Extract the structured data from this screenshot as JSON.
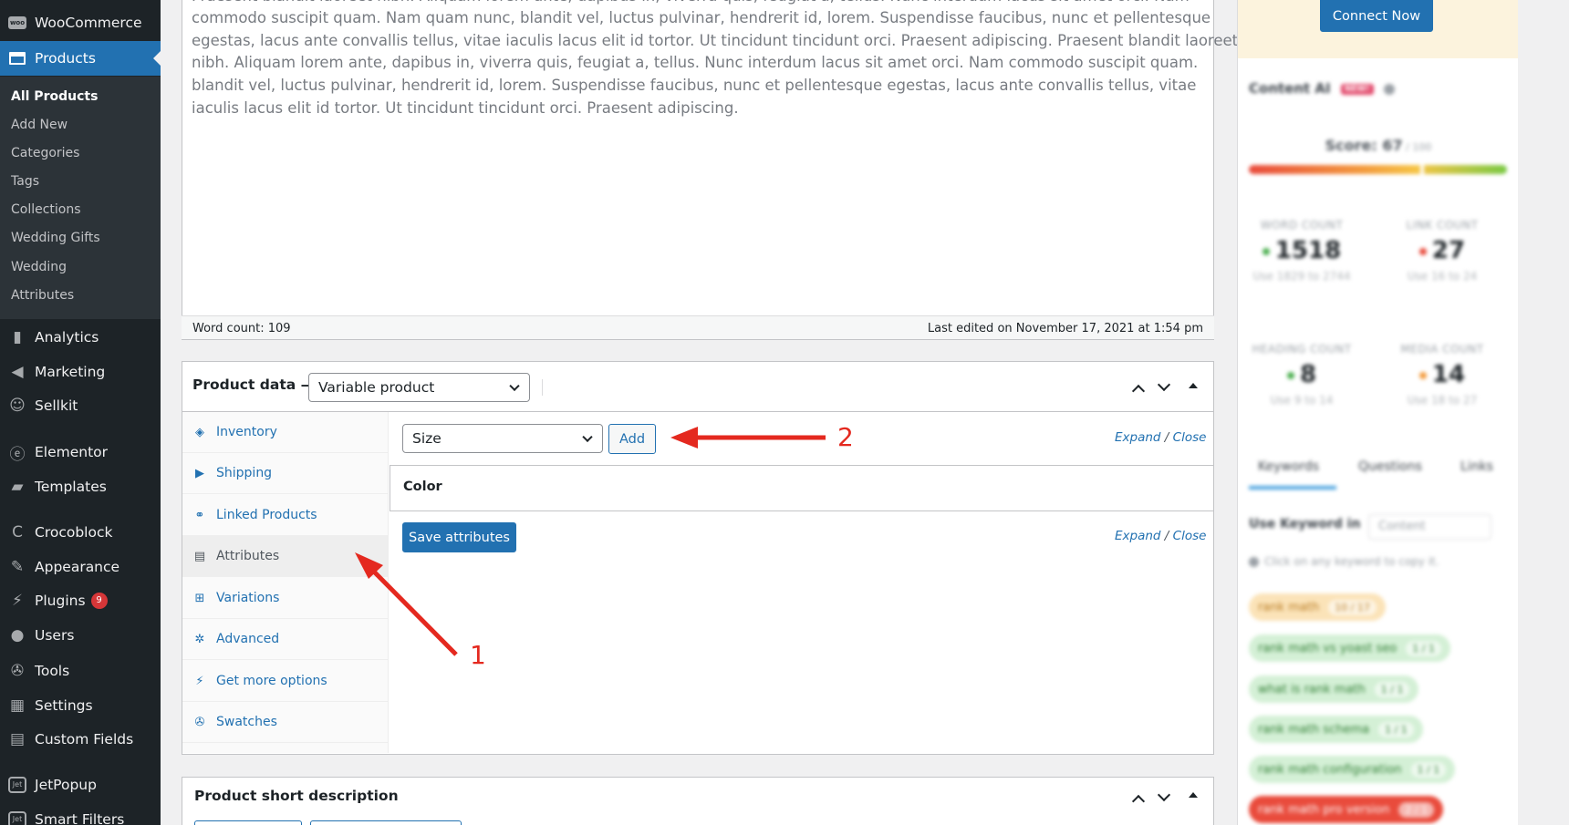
{
  "sidebar": {
    "woocommerce": "WooCommerce",
    "products": "Products",
    "submenu": [
      "All Products",
      "Add New",
      "Categories",
      "Tags",
      "Collections",
      "Wedding Gifts",
      "Wedding",
      "Attributes"
    ],
    "analytics": "Analytics",
    "marketing": "Marketing",
    "sellkit": "Sellkit",
    "elementor": "Elementor",
    "templates": "Templates",
    "crocoblock": "Crocoblock",
    "appearance": "Appearance",
    "plugins": "Plugins",
    "plugins_badge": "9",
    "users": "Users",
    "tools": "Tools",
    "settings": "Settings",
    "custom_fields": "Custom Fields",
    "jetpopup": "JetPopup",
    "smart_filters": "Smart Filters"
  },
  "editor": {
    "line0": "Praesent blandit laoreet nibh. Aliquam lorem ante, dapibus in, viverra quis, feugiat a, tellus. Nunc interdum lacus sit amet orci. Nam",
    "line1": "commodo suscipit quam. Nam quam nunc, blandit vel, luctus pulvinar, hendrerit id, lorem. Suspendisse faucibus, nunc et pellentesque",
    "line2": "egestas, lacus ante convallis tellus, vitae iaculis lacus elit id tortor. Ut tincidunt tincidunt orci. Praesent adipiscing. Praesent blandit laoreet",
    "line3": "nibh. Aliquam lorem ante, dapibus in, viverra quis, feugiat a, tellus. Nunc interdum lacus sit amet orci. Nam commodo suscipit quam.",
    "line4": "blandit vel, luctus pulvinar, hendrerit id, lorem. Suspendisse faucibus, nunc et pellentesque egestas, lacus ante convallis tellus, vitae",
    "line5": "iaculis lacus elit id tortor. Ut tincidunt tincidunt orci. Praesent adipiscing.",
    "word_count": "Word count: 109",
    "last_edited": "Last edited on November 17, 2021 at 1:54 pm"
  },
  "product_data": {
    "title": "Product data —",
    "type_selected": "Variable product",
    "tabs": [
      "Inventory",
      "Shipping",
      "Linked Products",
      "Attributes",
      "Variations",
      "Advanced",
      "Get more options",
      "Swatches"
    ],
    "attr_select": "Size",
    "add_label": "Add",
    "expand": "Expand",
    "slash": " / ",
    "close": "Close",
    "attribute_row": "Color",
    "save_label": "Save attributes"
  },
  "annotations": {
    "one": "1",
    "two": "2"
  },
  "short_desc": {
    "title": "Product short description"
  },
  "rank_math": {
    "connect": "Connect Now",
    "content_ai": "Content AI",
    "new_badge": "NEW!",
    "score_label": "Score: 67",
    "score_total": " / 100",
    "score_value": 67,
    "stats": [
      {
        "label": "WORD COUNT",
        "value": "1518",
        "hint": "Use 1829 to 2744"
      },
      {
        "label": "LINK COUNT",
        "value": "27",
        "hint": "Use 16 to 24"
      },
      {
        "label": "HEADING COUNT",
        "value": "8",
        "hint": "Use 9 to 14"
      },
      {
        "label": "MEDIA COUNT",
        "value": "14",
        "hint": "Use 18 to 27"
      }
    ],
    "tabs": [
      "Keywords",
      "Questions",
      "Links"
    ],
    "use_keyword_in": "Use Keyword in",
    "content_select": "Content",
    "click_hint": "Click on any keyword to copy it.",
    "keywords": [
      {
        "text": "rank math",
        "count": "10 / 17"
      },
      {
        "text": "rank math vs yoast seo",
        "count": "1 / 1"
      },
      {
        "text": "what is rank math",
        "count": "1 / 1"
      },
      {
        "text": "rank math schema",
        "count": "1 / 1"
      },
      {
        "text": "rank math configuration",
        "count": "1 / 1"
      },
      {
        "text": "rank math pro version",
        "count": "2 / 1"
      }
    ]
  },
  "colors": {
    "admin_blue": "#2271b1",
    "sidebar_bg": "#1d2327",
    "annotation_red": "#e4291f"
  }
}
